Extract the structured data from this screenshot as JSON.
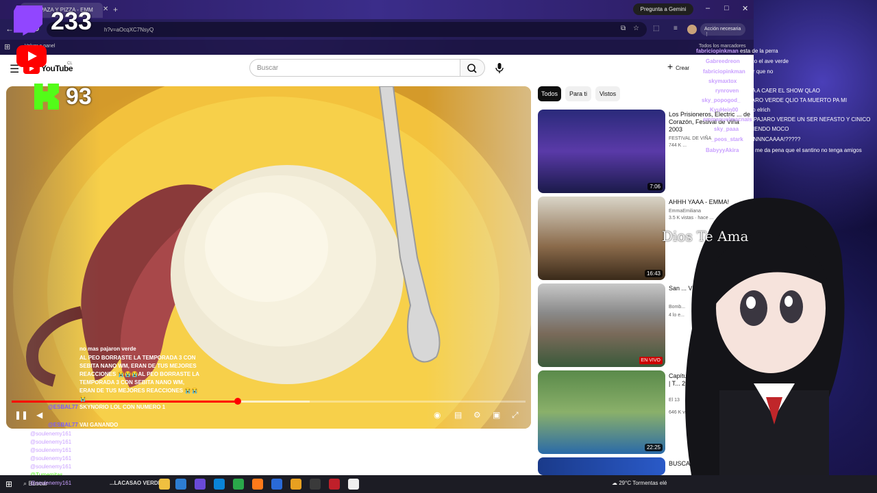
{
  "browser": {
    "tab_title": "(50) PAZA Y PIZZA - EMM",
    "url": "h?v=aOcqXC7NsyQ",
    "gemini_label": "Pregunta a Gemini",
    "action_label": "Acción necesaria",
    "bookmark_left": "Volver a panel",
    "bookmark_right": "Todos los marcadores"
  },
  "youtube": {
    "logo_text": "YouTube",
    "logo_country": "CL",
    "search_placeholder": "Buscar",
    "create_label": "Crear",
    "chips": [
      "Todos",
      "Para ti",
      "Vistos"
    ],
    "progress": {
      "played_fraction": 0.44,
      "buffered_fraction": 0.58
    },
    "recommendations": [
      {
        "title": "Los Prisioneros, Electric ... de Corazón, Festival de Viña 2003",
        "channel": "FESTIVAL DE VIÑA",
        "views": "744 K ...",
        "duration": "7:06",
        "live": false
      },
      {
        "title": "AHHH YAAA - EMMA!",
        "channel": "EmmaEmiliana",
        "views": "3.5 K vistas · hace ...",
        "duration": "16:43",
        "live": false
      },
      {
        "title": "San ... VIVO",
        "channel": "Bomb...",
        "views": "4 lo e...",
        "duration": "",
        "live": true,
        "live_label": "EN VIVO"
      },
      {
        "title": "Capítulo 10: M... Diego y Glot | T... 2005",
        "channel": "El 13",
        "views": "646 K vistas",
        "duration": "22:25",
        "live": false
      },
      {
        "title": "BUSCANDO ...",
        "channel": "",
        "views": "",
        "duration": "",
        "live": false
      }
    ]
  },
  "overlay": {
    "twitch_count": "233",
    "kick_count": "93",
    "watermark": "Dios Te Ama"
  },
  "chat_right": [
    {
      "user": "fabriciopinkman",
      "msg": "esta de la perra"
    },
    {
      "user": "Gabreedreon",
      "msg": "el pico el ave verde"
    },
    {
      "user": "fabriciopinkman",
      "msg": "por que no"
    },
    {
      "user": "skymaxtox",
      "msg": ""
    },
    {
      "user": "rynroven",
      "msg": "TE VA A CAER EL SHOW QLAO"
    },
    {
      "user": "sky_popogod_",
      "msg": "PAJARO VERDE QLIO TA MUERTO PA MI"
    },
    {
      "user": "KyuHein00",
      "msg": "el loco elrich"
    },
    {
      "user": "emmanuelmacnals",
      "msg": "PAJARO VERDE UN SER NEFASTO Y CINICO"
    },
    {
      "user": "sky_paaa",
      "msg": "COMIENDO MOCO"
    },
    {
      "user": "_peos_stark",
      "msg": "ETINNNCAAAA!?????"
    },
    {
      "user": "BabyyyAkira",
      "msg": "ya mi me da pena que el santino no tenga amigos"
    }
  ],
  "chat_left": [
    {
      "user": "",
      "msg": "no mas pajaron verde"
    },
    {
      "user": "",
      "msg": "AL PEO BORRASTE LA TEMPORADA 3 CON SEBITA NANO WM, ERAN DE TUS MEJORES REACCIONES 😭😭😭AL PEO BORRASTE LA TEMPORADA 3 CON SEBITA NANO WM, ERAN DE TUS MEJORES REACCIONES 😭😭😭"
    },
    {
      "user": "@ESBAL77",
      "msg": "SKYNORIO LOL CON NUMERO 1"
    },
    {
      "user": "@ESBAL77",
      "msg": "VAI GANANDO"
    }
  ],
  "chat_bottom": [
    {
      "user": "@soulenemy161",
      "msg": ""
    },
    {
      "user": "@soulenemy161",
      "msg": ""
    },
    {
      "user": "@soulenemy161",
      "msg": ""
    },
    {
      "user": "@soulenemy161",
      "msg": ""
    },
    {
      "user": "@soulenemy161",
      "msg": ""
    },
    {
      "user": "@Tumemitas",
      "msg": ""
    },
    {
      "user": "@soulenemy161",
      "msg": ""
    }
  ],
  "taskbar": {
    "search_label": "Buscar",
    "ticker": "...LACASAO VERDE",
    "weather": "29°C  Tormentas elé"
  },
  "colors": {
    "youtube_red": "#ff0000",
    "twitch_purple": "#9146ff",
    "kick_green": "#53fc18"
  }
}
